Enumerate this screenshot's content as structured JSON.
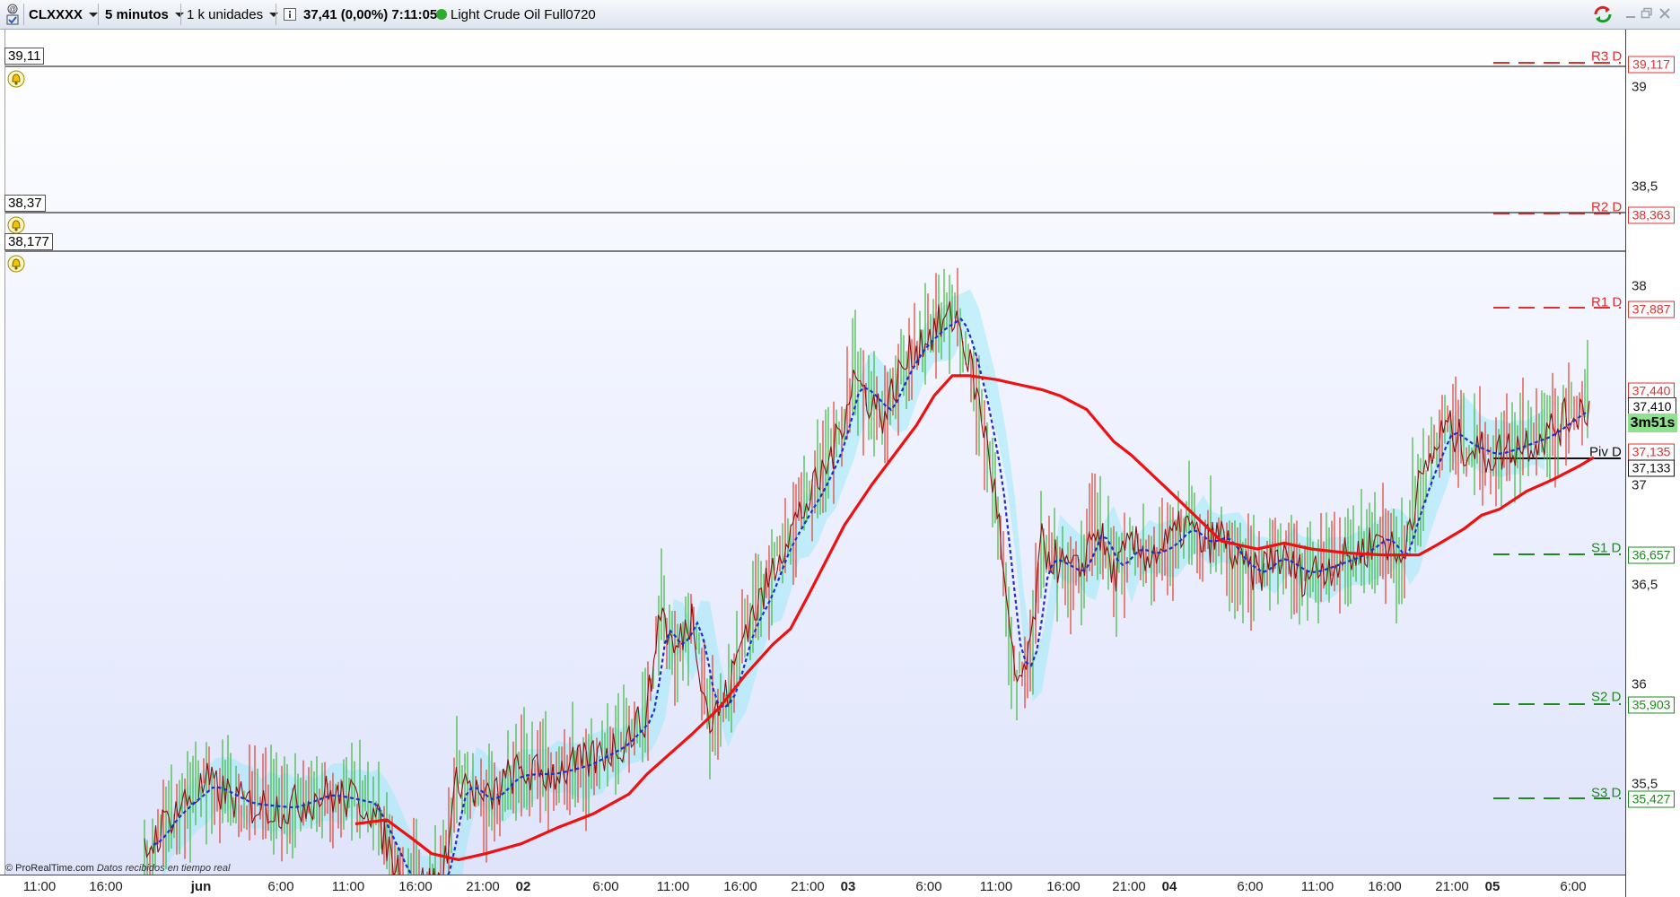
{
  "toolbar": {
    "symbol": "CLXXXX",
    "timeframe": "5 minutos",
    "units": "1 k unidades",
    "quote": "37,41 (0,00%) 7:11:05",
    "instrument": "Light Crude Oil Full0720",
    "status_color": "#2eaa2e"
  },
  "alerts": [
    {
      "value": "39,11"
    },
    {
      "value": "38,37"
    },
    {
      "value": "38,177"
    }
  ],
  "price_axis": {
    "ticks": [
      "39",
      "38,5",
      "38",
      "37",
      "36,5",
      "36",
      "35,5"
    ],
    "current_price": "37,410",
    "timer": "3m51s"
  },
  "pivots": {
    "r3": {
      "label": "R3 D",
      "value": "39,117"
    },
    "r2": {
      "label": "R2 D",
      "value": "38,363"
    },
    "r1": {
      "label": "R1 D",
      "value": "37,887"
    },
    "last": {
      "value": "37,440"
    },
    "piv_value": {
      "value": "37,135"
    },
    "piv": {
      "label": "Piv D",
      "value": "37,133"
    },
    "s1": {
      "label": "S1 D",
      "value": "36,657"
    },
    "s2": {
      "label": "S2 D",
      "value": "35,903"
    },
    "s3": {
      "label": "S3 D",
      "value": "35,427"
    }
  },
  "time_axis": [
    {
      "label": "11:00",
      "bold": false
    },
    {
      "label": "16:00",
      "bold": false
    },
    {
      "label": "jun",
      "bold": true
    },
    {
      "label": "6:00",
      "bold": false
    },
    {
      "label": "11:00",
      "bold": false
    },
    {
      "label": "16:00",
      "bold": false
    },
    {
      "label": "21:00",
      "bold": false
    },
    {
      "label": "02",
      "bold": true
    },
    {
      "label": "6:00",
      "bold": false
    },
    {
      "label": "11:00",
      "bold": false
    },
    {
      "label": "16:00",
      "bold": false
    },
    {
      "label": "21:00",
      "bold": false
    },
    {
      "label": "03",
      "bold": true
    },
    {
      "label": "6:00",
      "bold": false
    },
    {
      "label": "11:00",
      "bold": false
    },
    {
      "label": "16:00",
      "bold": false
    },
    {
      "label": "21:00",
      "bold": false
    },
    {
      "label": "04",
      "bold": true
    },
    {
      "label": "6:00",
      "bold": false
    },
    {
      "label": "11:00",
      "bold": false
    },
    {
      "label": "16:00",
      "bold": false
    },
    {
      "label": "21:00",
      "bold": false
    },
    {
      "label": "05",
      "bold": true
    },
    {
      "label": "6:00",
      "bold": false
    }
  ],
  "footer": {
    "copyright": "© ProRealTime.com",
    "note": "Datos recibidos en tiempo real"
  },
  "colors": {
    "price_line": "#8b1010",
    "moving_average": "#ee1111",
    "tenkan": "#1a2fd0",
    "cloud": "#9fe9f7",
    "resistance": "#e03030",
    "support": "#1d8a1d",
    "timer_bg": "#8fe08f"
  }
}
